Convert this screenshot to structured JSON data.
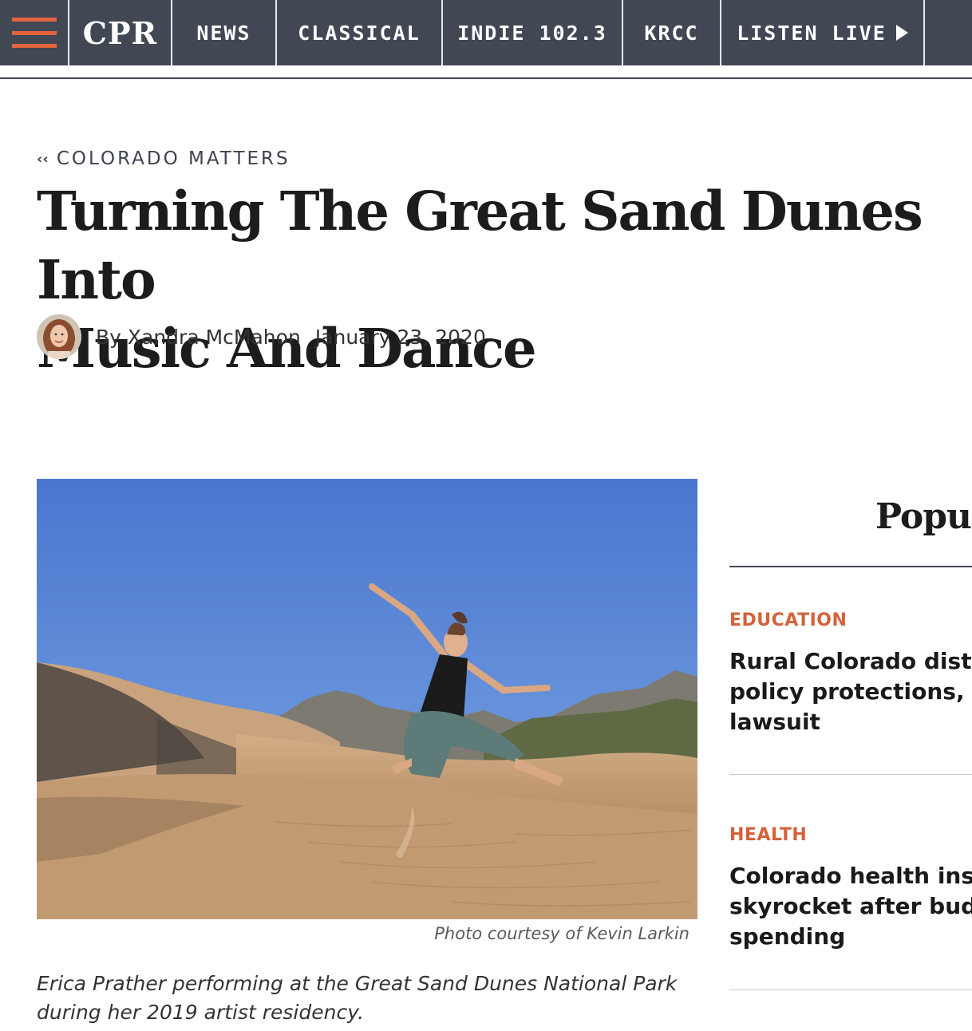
{
  "nav": {
    "logo": "CPR",
    "items": [
      "NEWS",
      "CLASSICAL",
      "INDIE 102.3",
      "KRCC"
    ],
    "listen_live": "LISTEN LIVE",
    "menu_icon": "hamburger-icon",
    "play_icon": "play-icon",
    "accent_color": "#e1643d",
    "bar_color": "#424754"
  },
  "article": {
    "back_icon": "double-chevron-left-icon",
    "kicker": "COLORADO MATTERS",
    "title_line1": "Turning The Great Sand Dunes Into",
    "title_line2": "Music And Dance",
    "byline": "By Xandra McMahon",
    "date": "January 23, 2020",
    "photo_credit": "Photo courtesy of Kevin Larkin",
    "caption_line1": "Erica Prather performing at the Great Sand Dunes National Park",
    "caption_line2": "during her 2019 artist residency."
  },
  "sidebar": {
    "title": "Popul",
    "stories": [
      {
        "category": "EDUCATION",
        "line1": "Rural Colorado distri",
        "line2": "policy protections, se",
        "line3": "lawsuit"
      },
      {
        "category": "HEALTH",
        "line1": "Colorado health insur",
        "line2": "skyrocket after budge",
        "line3": "spending"
      }
    ],
    "category_color": "#d4623a"
  }
}
